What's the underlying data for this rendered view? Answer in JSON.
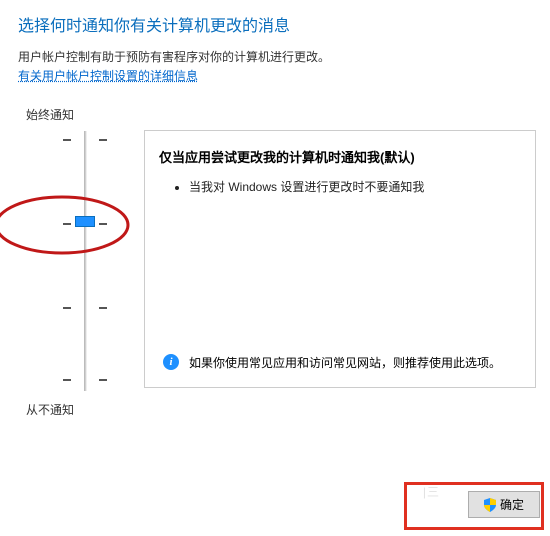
{
  "header": {
    "title": "选择何时通知你有关计算机更改的消息"
  },
  "description": "用户帐户控制有助于预防有害程序对你的计算机进行更改。",
  "link_text": "有关用户帐户控制设置的详细信息",
  "slider": {
    "top_label": "始终通知",
    "bottom_label": "从不通知",
    "level": 1
  },
  "panel": {
    "title": "仅当应用尝试更改我的计算机时通知我(默认)",
    "bullets": [
      "当我对 Windows 设置进行更改时不要通知我"
    ],
    "info": "如果你使用常见应用和访问常见网站，则推荐使用此选项。"
  },
  "buttons": {
    "ok": "确定"
  },
  "annotations": {
    "circle_color": "#c01818",
    "rect_color": "#e03020"
  }
}
